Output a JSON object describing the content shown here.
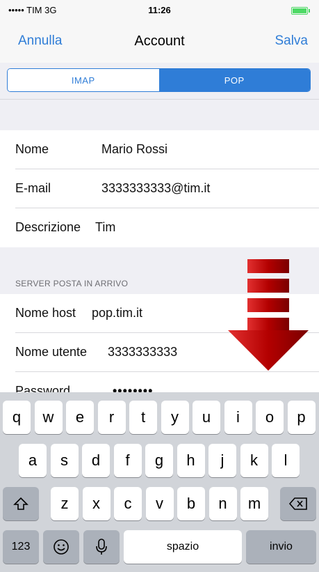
{
  "status_bar": {
    "carrier": "••••• TIM 3G",
    "time": "11:26"
  },
  "nav": {
    "cancel": "Annulla",
    "title": "Account",
    "save": "Salva"
  },
  "segmented": {
    "options": [
      "IMAP",
      "POP"
    ],
    "selected": "POP"
  },
  "account": {
    "name_label": "Nome",
    "name_value": "Mario Rossi",
    "email_label": "E-mail",
    "email_value": "3333333333@tim.it",
    "desc_label": "Descrizione",
    "desc_value": "Tim"
  },
  "incoming": {
    "header": "SERVER POSTA IN ARRIVO",
    "host_label": "Nome host",
    "host_value": "pop.tim.it",
    "user_label": "Nome utente",
    "user_value": "3333333333",
    "password_label": "Password",
    "password_value": "••••••••"
  },
  "keyboard": {
    "row1": [
      "q",
      "w",
      "e",
      "r",
      "t",
      "y",
      "u",
      "i",
      "o",
      "p"
    ],
    "row2": [
      "a",
      "s",
      "d",
      "f",
      "g",
      "h",
      "j",
      "k",
      "l"
    ],
    "row3": [
      "z",
      "x",
      "c",
      "v",
      "b",
      "n",
      "m"
    ],
    "numbers_key": "123",
    "space_key": "spazio",
    "return_key": "invio"
  },
  "colors": {
    "accent": "#2f7dd7",
    "arrow": "#cc1111"
  }
}
